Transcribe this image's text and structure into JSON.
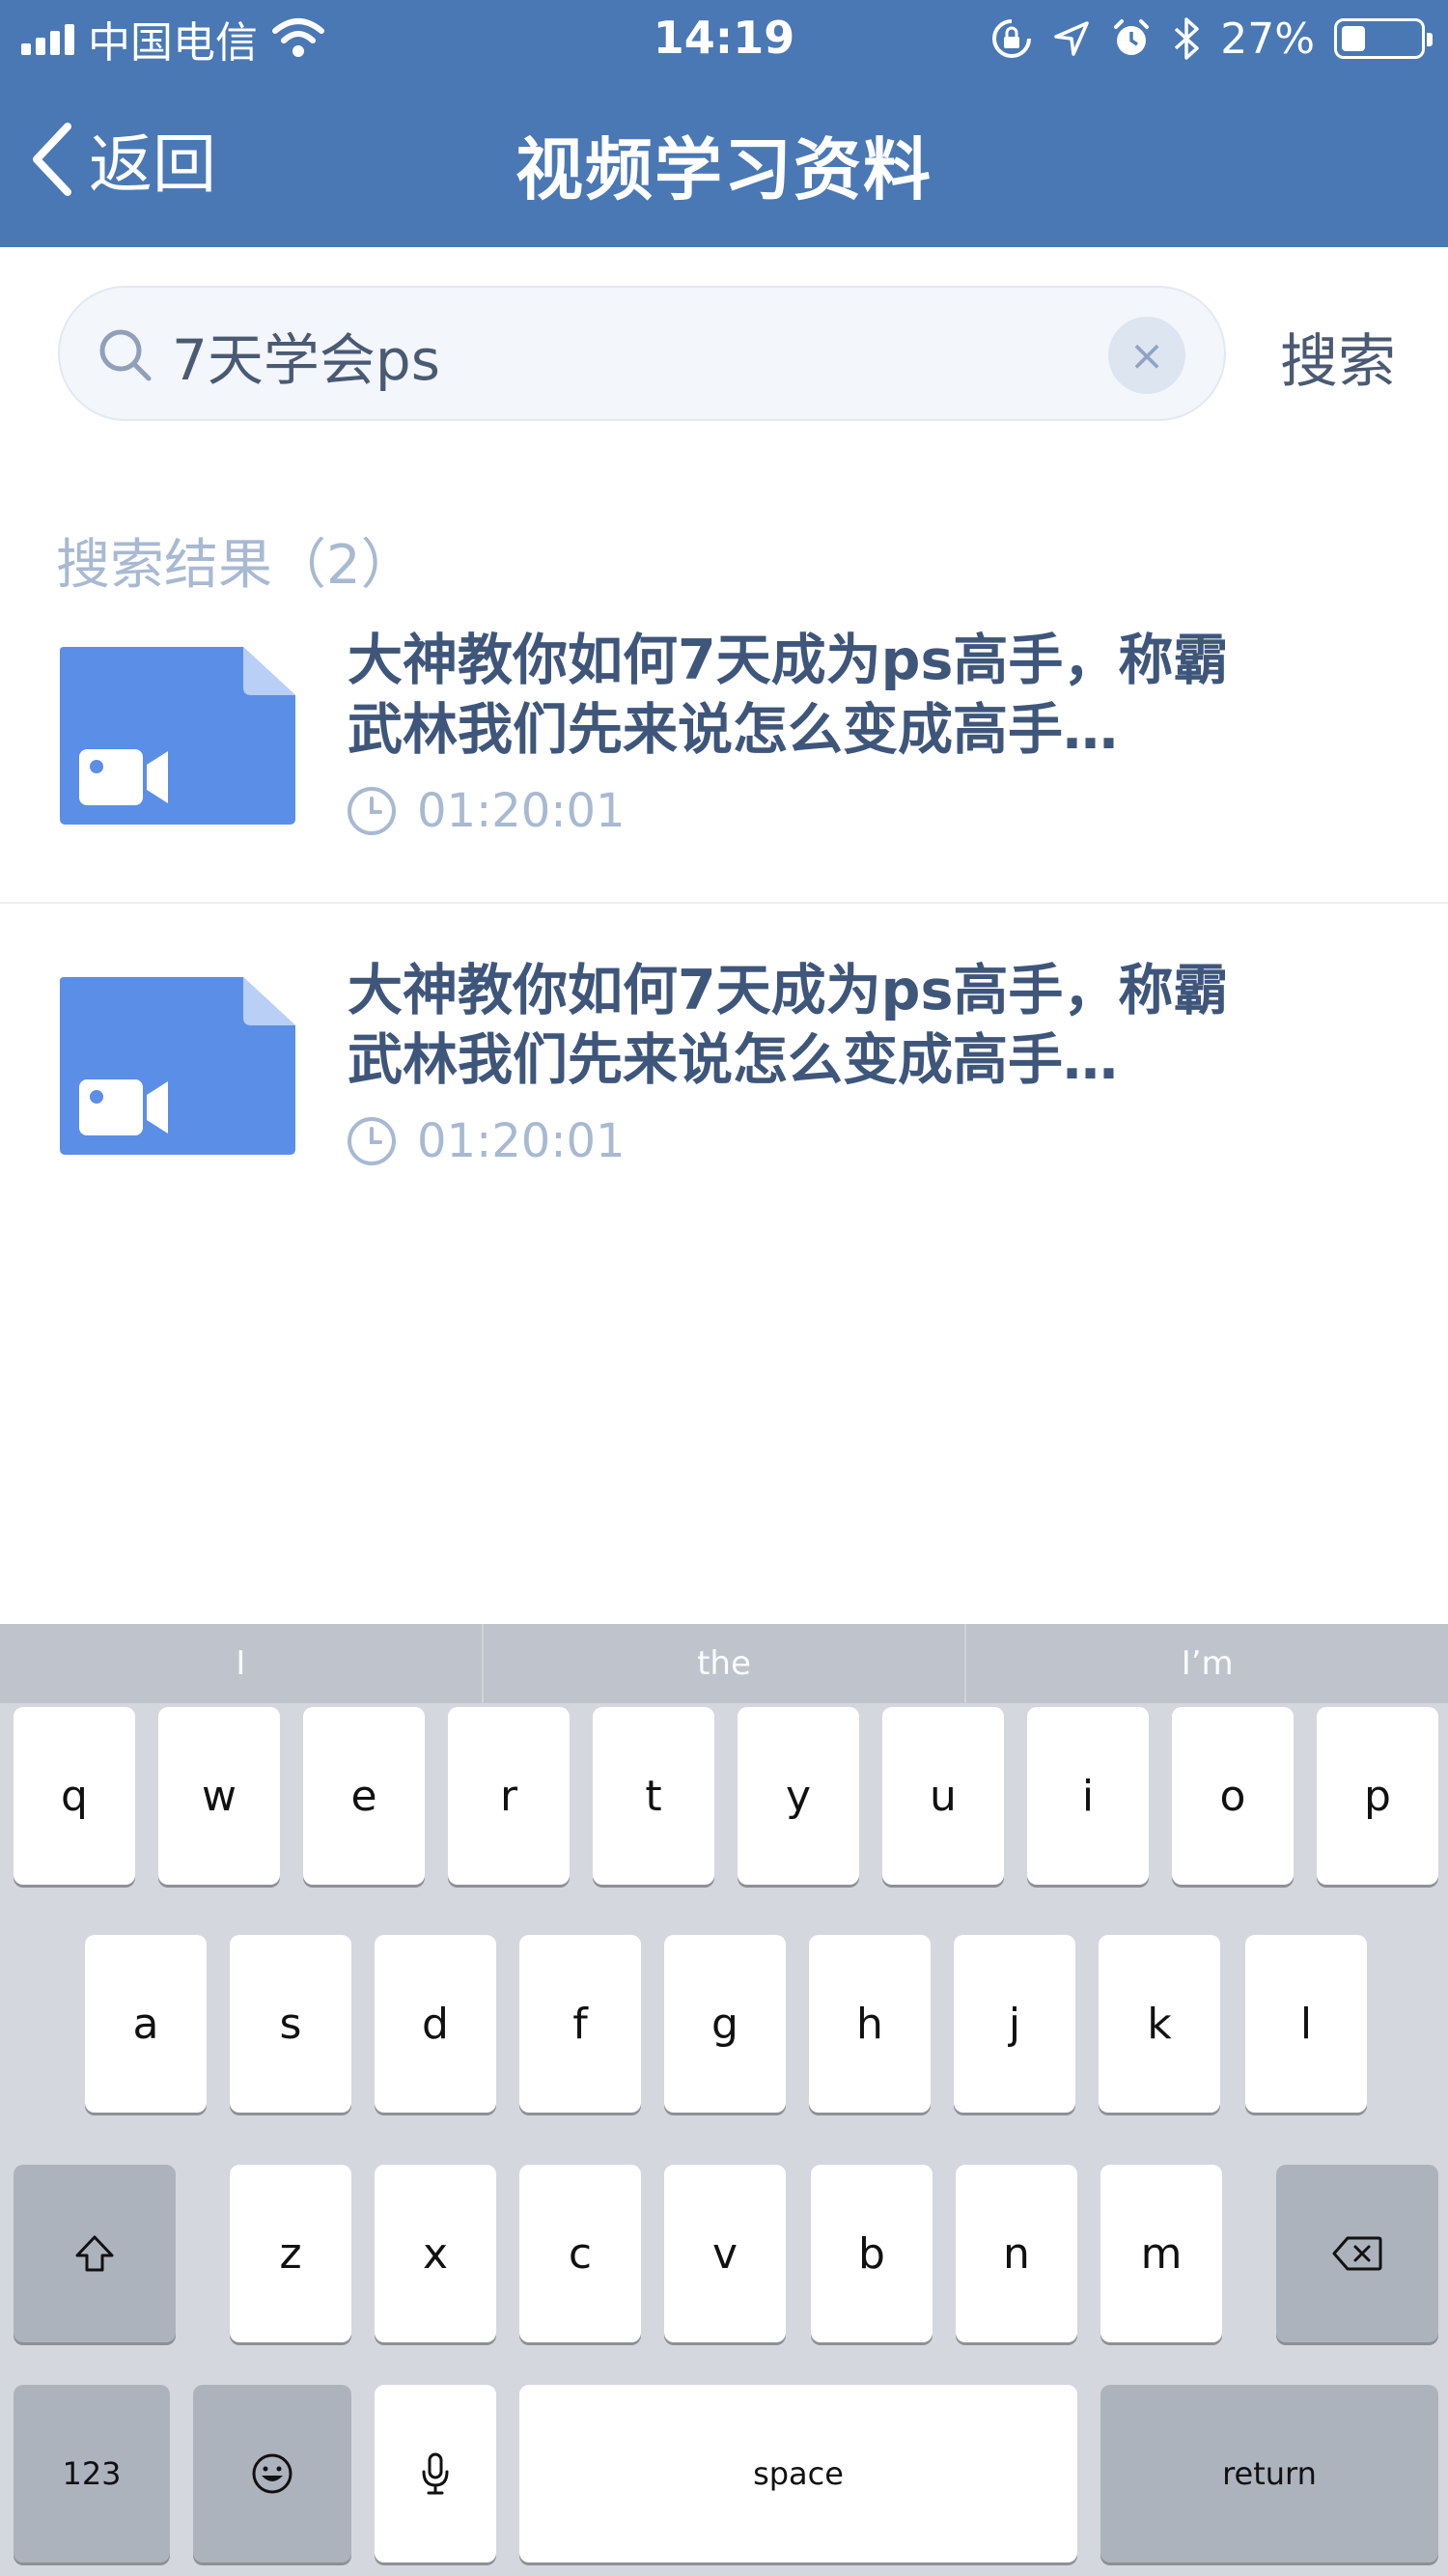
{
  "status_bar": {
    "carrier": "中国电信",
    "time": "14:19",
    "battery_percent": "27%",
    "battery_level": 0.27,
    "icons": [
      "signal-icon",
      "wifi-icon",
      "orientation-lock-icon",
      "location-icon",
      "alarm-icon",
      "bluetooth-icon",
      "battery-icon"
    ]
  },
  "nav": {
    "back_label": "返回",
    "title": "视频学习资料"
  },
  "search": {
    "value": "7天学会ps",
    "clear_symbol": "×",
    "action_label": "搜索"
  },
  "results": {
    "label": "搜索结果（2）",
    "items": [
      {
        "title_line1": "大神教你如何7天成为ps高手，称霸",
        "title_line2": "武林我们先来说怎么变成高手…",
        "duration": "01:20:01"
      },
      {
        "title_line1": "大神教你如何7天成为ps高手，称霸",
        "title_line2": "武林我们先来说怎么变成高手…",
        "duration": "01:20:01"
      }
    ]
  },
  "colors": {
    "header": "#4a78b4",
    "thumb": "#5b8ee6",
    "title": "#3f567b",
    "muted": "#a8b9d2"
  },
  "keyboard": {
    "suggestions": [
      "I",
      "the",
      "I’m"
    ],
    "row1": [
      "q",
      "w",
      "e",
      "r",
      "t",
      "y",
      "u",
      "i",
      "o",
      "p"
    ],
    "row2": [
      "a",
      "s",
      "d",
      "f",
      "g",
      "h",
      "j",
      "k",
      "l"
    ],
    "row3": [
      "z",
      "x",
      "c",
      "v",
      "b",
      "n",
      "m"
    ],
    "numbers_label": "123",
    "space_label": "space",
    "return_label": "return"
  }
}
